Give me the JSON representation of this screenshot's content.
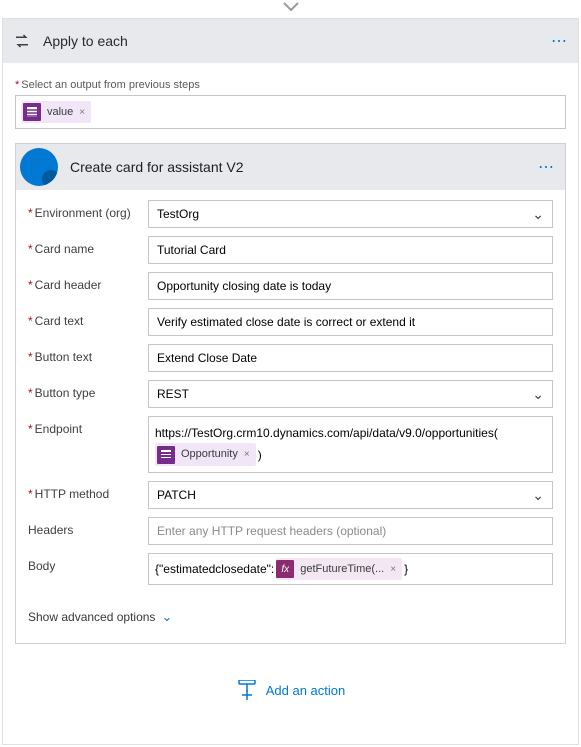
{
  "connector_icon": "chevron-down",
  "outer": {
    "icon": "apply-each-icon",
    "title": "Apply to each",
    "menu": "⋯"
  },
  "prev_output_label": "Select an output from previous steps",
  "value_chip": {
    "label": "value",
    "remove": "×"
  },
  "inner": {
    "title": "Create card for assistant V2",
    "menu": "⋯"
  },
  "fields": {
    "env": {
      "label": "Environment (org)",
      "value": "TestOrg"
    },
    "cardname": {
      "label": "Card name",
      "value": "Tutorial Card"
    },
    "cardheader": {
      "label": "Card header",
      "value": "Opportunity closing date is today"
    },
    "cardtext": {
      "label": "Card text",
      "value": "Verify estimated close date is correct or extend it"
    },
    "btntext": {
      "label": "Button text",
      "value": "Extend Close Date"
    },
    "btntype": {
      "label": "Button type",
      "value": "REST"
    },
    "endpoint": {
      "label": "Endpoint",
      "url": "https://TestOrg.crm10.dynamics.com/api/data/v9.0/opportunities(",
      "chip": "Opportunity",
      "chip_x": "×",
      "closing": ")"
    },
    "httpmethod": {
      "label": "HTTP method",
      "value": "PATCH"
    },
    "headers": {
      "label": "Headers",
      "placeholder": "Enter any HTTP request headers (optional)"
    },
    "body": {
      "label": "Body",
      "prefix": "{\"estimatedclosedate\":",
      "fx": "getFutureTime(...",
      "fx_x": "×",
      "suffix": "}"
    }
  },
  "advanced": "Show advanced options",
  "add_action": "Add an action"
}
